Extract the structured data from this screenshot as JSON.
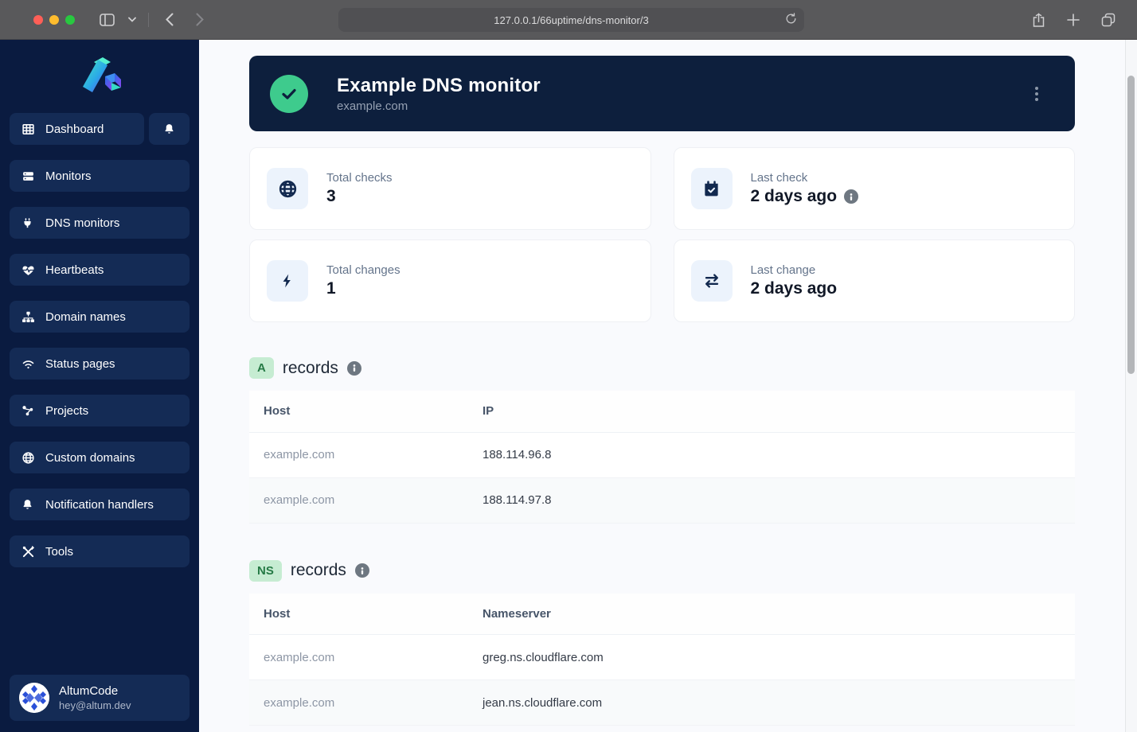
{
  "browser": {
    "url": "127.0.0.1/66uptime/dns-monitor/3"
  },
  "sidebar": {
    "items": [
      {
        "label": "Dashboard",
        "icon": "grid-icon"
      },
      {
        "label": "Monitors",
        "icon": "server-icon"
      },
      {
        "label": "DNS monitors",
        "icon": "plug-icon"
      },
      {
        "label": "Heartbeats",
        "icon": "heart-pulse-icon"
      },
      {
        "label": "Domain names",
        "icon": "sitemap-icon"
      },
      {
        "label": "Status pages",
        "icon": "wifi-icon"
      },
      {
        "label": "Projects",
        "icon": "share-nodes-icon"
      },
      {
        "label": "Custom domains",
        "icon": "globe-icon"
      },
      {
        "label": "Notification handlers",
        "icon": "bell-icon"
      },
      {
        "label": "Tools",
        "icon": "tools-icon"
      }
    ],
    "user": {
      "name": "AltumCode",
      "email": "hey@altum.dev"
    }
  },
  "monitor": {
    "title": "Example DNS monitor",
    "domain": "example.com",
    "status": "up"
  },
  "stats": [
    {
      "label": "Total checks",
      "value": "3",
      "icon": "globe-icon"
    },
    {
      "label": "Last check",
      "value": "2 days ago",
      "icon": "calendar-check-icon",
      "has_info": true
    },
    {
      "label": "Total changes",
      "value": "1",
      "icon": "bolt-icon"
    },
    {
      "label": "Last change",
      "value": "2 days ago",
      "icon": "arrows-right-left-icon"
    }
  ],
  "sections": [
    {
      "badge": "A",
      "title": "records",
      "columns": {
        "c1": "Host",
        "c2": "IP"
      },
      "rows": [
        {
          "host": "example.com",
          "value": "188.114.96.8"
        },
        {
          "host": "example.com",
          "value": "188.114.97.8"
        }
      ]
    },
    {
      "badge": "NS",
      "title": "records",
      "columns": {
        "c1": "Host",
        "c2": "Nameserver"
      },
      "rows": [
        {
          "host": "example.com",
          "value": "greg.ns.cloudflare.com"
        },
        {
          "host": "example.com",
          "value": "jean.ns.cloudflare.com"
        }
      ]
    }
  ],
  "colors": {
    "sidebar_bg": "#0a1b40",
    "sidebar_button_bg": "#142b55",
    "header_card_bg": "#0d1f3d",
    "status_green": "#3ecb8d",
    "badge_green_bg": "#c6ecd2",
    "badge_green_text": "#257a45",
    "page_bg": "#f9fafd"
  }
}
